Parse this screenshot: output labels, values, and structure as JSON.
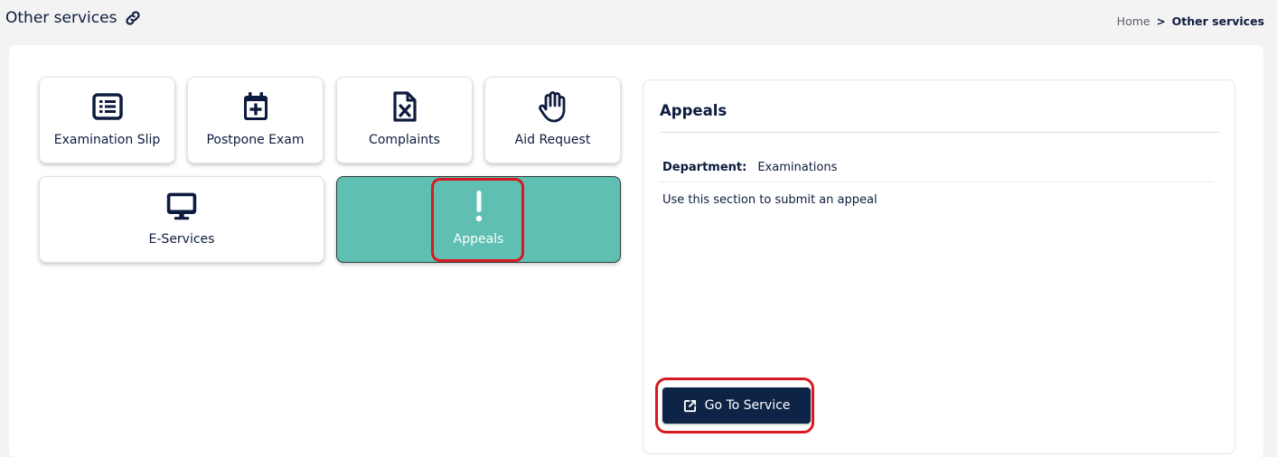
{
  "header": {
    "title": "Other services",
    "title_icon": "link-icon",
    "breadcrumb": {
      "home": "Home",
      "separator": ">",
      "current": "Other services"
    }
  },
  "services": [
    {
      "label": "Examination Slip",
      "icon": "list-icon"
    },
    {
      "label": "Postpone Exam",
      "icon": "calendar-plus-icon"
    },
    {
      "label": "Complaints",
      "icon": "file-x-icon"
    },
    {
      "label": "Aid Request",
      "icon": "hand-icon"
    },
    {
      "label": "E-Services",
      "icon": "monitor-icon"
    },
    {
      "label": "Appeals",
      "icon": "exclamation-icon",
      "selected": true
    }
  ],
  "detail": {
    "title": "Appeals",
    "department_label": "Department:",
    "department_value": "Examinations",
    "description": "Use this section to submit an appeal",
    "button_label": "Go To Service",
    "button_icon": "external-link-icon"
  },
  "colors": {
    "accent_teal": "#5ebfb2",
    "navy": "#0d2447",
    "text": "#0d1b3e",
    "highlight_red": "#d8191f"
  }
}
